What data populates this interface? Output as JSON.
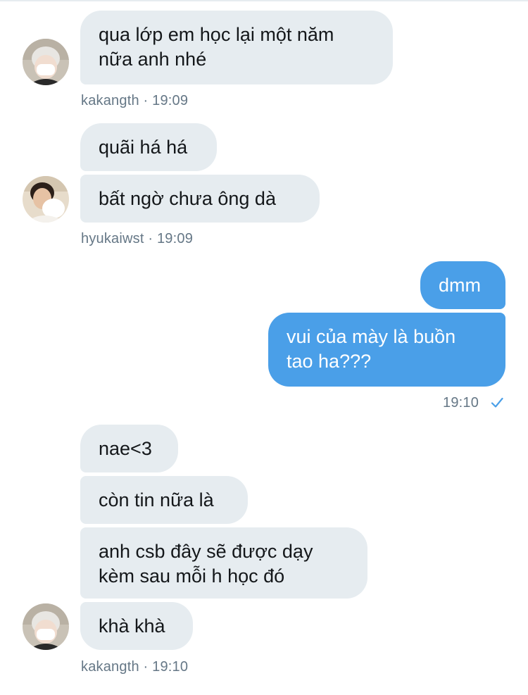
{
  "messages": {
    "m1": "qua lớp em học lại một năm",
    "m1b": "nữa anh nhé",
    "m2": "quãi há há",
    "m3": "bất ngờ chưa ông dà",
    "m4": "dmm",
    "m5": "vui của mày là buồn",
    "m5b": "tao ha???",
    "m6": "nae<3",
    "m7": "còn tin nữa là",
    "m8": "anh csb đây sẽ được dạy",
    "m8b": "kèm sau mỗi h học đó",
    "m9": "khà khà"
  },
  "meta": {
    "g1": "kakangth · 19:09",
    "g2": "hyukaiwst · 19:09",
    "g3": "19:10",
    "g4": "kakangth · 19:10"
  },
  "colors": {
    "incoming_bubble": "#e6ecf0",
    "outgoing_bubble": "#4a9fe8",
    "meta_text": "#657786",
    "read_check": "#4a9fe8"
  },
  "icons": [
    "avatar-kakangth",
    "avatar-hyukaiwst",
    "read-check-icon"
  ]
}
